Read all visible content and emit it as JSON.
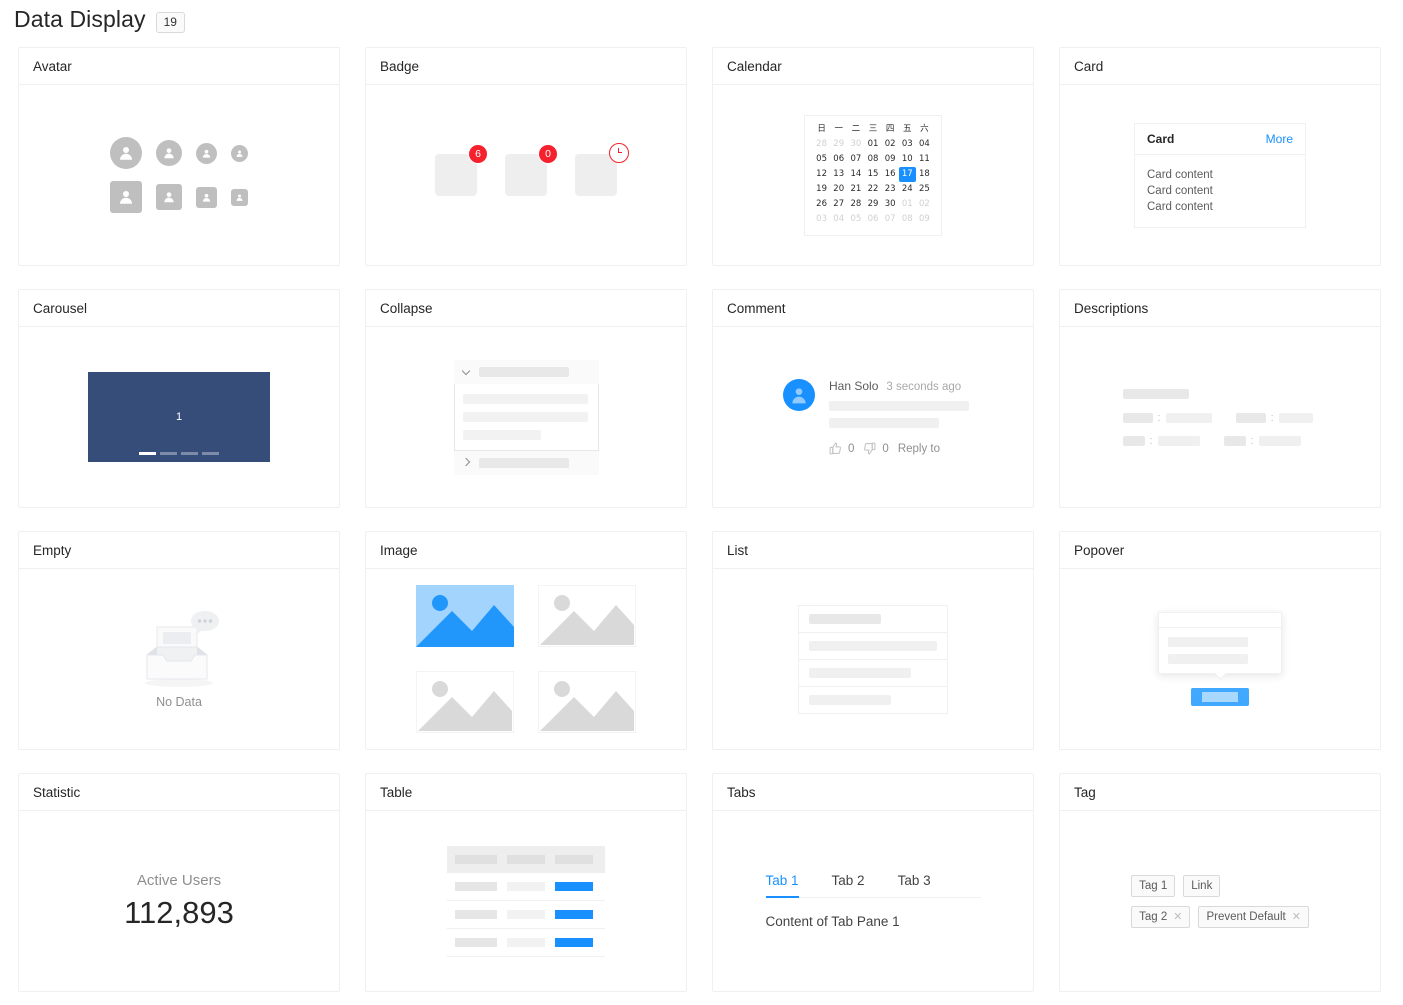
{
  "header": {
    "title": "Data Display",
    "badge": "19"
  },
  "cards": {
    "avatar": {
      "title": "Avatar"
    },
    "badge": {
      "title": "Badge",
      "counts": [
        "6",
        "0"
      ],
      "clock_icon": "clock-icon"
    },
    "calendar": {
      "title": "Calendar",
      "weekdays": [
        "日",
        "一",
        "二",
        "三",
        "四",
        "五",
        "六"
      ],
      "weeks": [
        [
          {
            "d": "28",
            "dim": true
          },
          {
            "d": "29",
            "dim": true
          },
          {
            "d": "30",
            "dim": true
          },
          {
            "d": "01"
          },
          {
            "d": "02"
          },
          {
            "d": "03"
          },
          {
            "d": "04"
          }
        ],
        [
          {
            "d": "05"
          },
          {
            "d": "06"
          },
          {
            "d": "07"
          },
          {
            "d": "08"
          },
          {
            "d": "09"
          },
          {
            "d": "10"
          },
          {
            "d": "11"
          }
        ],
        [
          {
            "d": "12"
          },
          {
            "d": "13"
          },
          {
            "d": "14"
          },
          {
            "d": "15"
          },
          {
            "d": "16"
          },
          {
            "d": "17",
            "sel": true
          },
          {
            "d": "18"
          }
        ],
        [
          {
            "d": "19"
          },
          {
            "d": "20"
          },
          {
            "d": "21"
          },
          {
            "d": "22"
          },
          {
            "d": "23"
          },
          {
            "d": "24"
          },
          {
            "d": "25"
          }
        ],
        [
          {
            "d": "26"
          },
          {
            "d": "27"
          },
          {
            "d": "28"
          },
          {
            "d": "29"
          },
          {
            "d": "30"
          },
          {
            "d": "01",
            "dim": true
          },
          {
            "d": "02",
            "dim": true
          }
        ],
        [
          {
            "d": "03",
            "dim": true
          },
          {
            "d": "04",
            "dim": true
          },
          {
            "d": "05",
            "dim": true
          },
          {
            "d": "06",
            "dim": true
          },
          {
            "d": "07",
            "dim": true
          },
          {
            "d": "08",
            "dim": true
          },
          {
            "d": "09",
            "dim": true
          }
        ]
      ],
      "selected_day": "17"
    },
    "card": {
      "title": "Card",
      "demo_title": "Card",
      "more_label": "More",
      "content_lines": [
        "Card content",
        "Card content",
        "Card content"
      ]
    },
    "carousel": {
      "title": "Carousel",
      "slide_label": "1",
      "slide_count": 4,
      "active_slide": 1
    },
    "collapse": {
      "title": "Collapse"
    },
    "comment": {
      "title": "Comment",
      "author": "Han Solo",
      "time": "3 seconds ago",
      "like_count": "0",
      "dislike_count": "0",
      "reply_label": "Reply to"
    },
    "descriptions": {
      "title": "Descriptions"
    },
    "empty": {
      "title": "Empty",
      "label": "No Data"
    },
    "image": {
      "title": "Image"
    },
    "list": {
      "title": "List"
    },
    "popover": {
      "title": "Popover"
    },
    "statistic": {
      "title": "Statistic",
      "label": "Active Users",
      "value": "112,893"
    },
    "table": {
      "title": "Table"
    },
    "tabs": {
      "title": "Tabs",
      "items": [
        {
          "label": "Tab 1",
          "active": true
        },
        {
          "label": "Tab 2",
          "active": false
        },
        {
          "label": "Tab 3",
          "active": false
        }
      ],
      "content": "Content of Tab Pane 1"
    },
    "tag": {
      "title": "Tag",
      "row1": [
        {
          "label": "Tag 1",
          "closable": false
        },
        {
          "label": "Link",
          "closable": false
        }
      ],
      "row2": [
        {
          "label": "Tag 2",
          "closable": true
        },
        {
          "label": "Prevent Default",
          "closable": true
        }
      ]
    }
  },
  "colors": {
    "primary": "#1890ff",
    "danger": "#f5222d",
    "carousel_bg": "#364d79",
    "placeholder": "#f0f0f0",
    "border": "#f0f0f0"
  }
}
